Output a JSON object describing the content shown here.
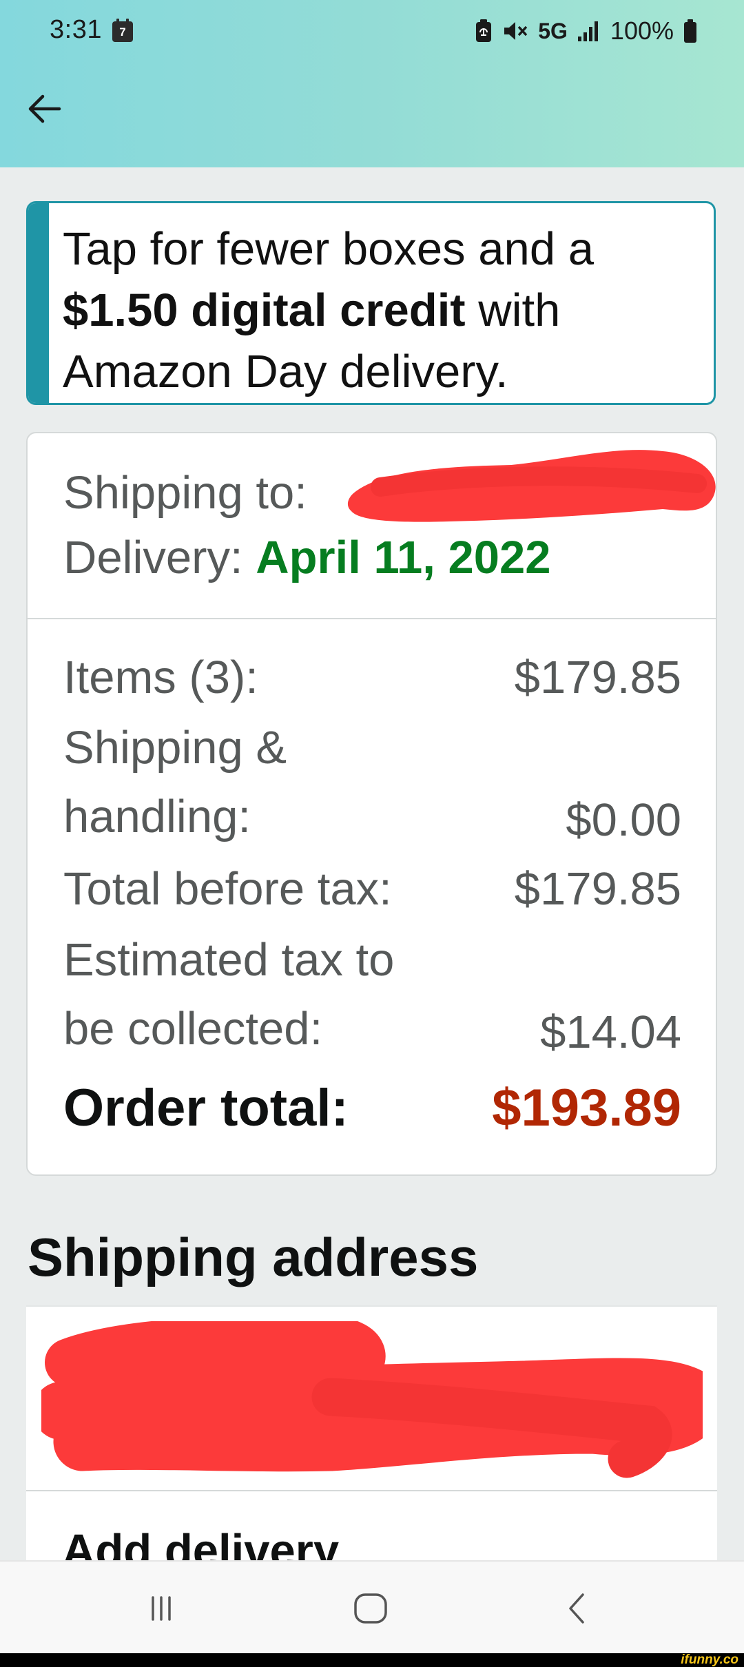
{
  "status_bar": {
    "time": "3:31",
    "calendar_day": "7",
    "network": "5G",
    "battery": "100%"
  },
  "header": {
    "back_icon": "arrow-left-icon"
  },
  "promo": {
    "text_before": "Tap for fewer boxes and a ",
    "text_bold": "$1.50 digital credit",
    "text_after": " with Amazon Day delivery.",
    "accent_color": "#1f95a6"
  },
  "summary": {
    "shipping_to_label": "Shipping to:",
    "delivery_label": "Delivery:",
    "delivery_date": "April 11, 2022",
    "delivery_color": "#067d20",
    "lines": [
      {
        "label": "Items (3):",
        "value": "$179.85"
      },
      {
        "label": "Shipping & handling:",
        "value": "$0.00"
      },
      {
        "label": "Total before tax:",
        "value": "$179.85"
      },
      {
        "label": "Estimated tax to be collected:",
        "value": "$14.04"
      }
    ],
    "order_total_label": "Order total:",
    "order_total_value": "$193.89",
    "order_total_color": "#b12704"
  },
  "shipping_address": {
    "heading": "Shipping address",
    "add_delivery_text": "Add delivery"
  },
  "nav_bar": {
    "recents_icon": "recents-icon",
    "home_icon": "home-icon",
    "back_icon": "back-chevron-icon"
  },
  "watermark": "ifunny.co"
}
